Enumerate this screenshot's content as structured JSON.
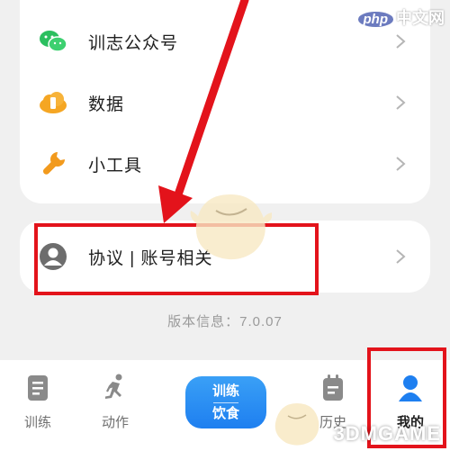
{
  "menu": {
    "items": [
      {
        "label": "训志公众号",
        "icon": "wechat-icon"
      },
      {
        "label": "数据",
        "icon": "data-cloud-icon"
      },
      {
        "label": "小工具",
        "icon": "wrench-icon"
      }
    ]
  },
  "account": {
    "label": "协议 | 账号相关",
    "icon": "avatar-icon"
  },
  "version_text": "版本信息：7.0.07",
  "tabbar": {
    "tabs": [
      {
        "label": "训练",
        "icon": "clipboard-icon"
      },
      {
        "label": "动作",
        "icon": "running-icon"
      },
      {
        "label": "历史",
        "icon": "calendar-icon"
      },
      {
        "label": "我的",
        "icon": "person-icon",
        "active": true
      }
    ],
    "center_line1": "训练",
    "center_line2": "饮食"
  },
  "watermark": {
    "site": "php",
    "site_suffix": "中文网",
    "brand": "3DMGAME"
  },
  "colors": {
    "highlight": "#e3131b",
    "accent_blue": "#1e7ff0",
    "wechat_green": "#2bbf5f",
    "data_orange": "#f5a623",
    "wrench_orange": "#f29a1d"
  }
}
